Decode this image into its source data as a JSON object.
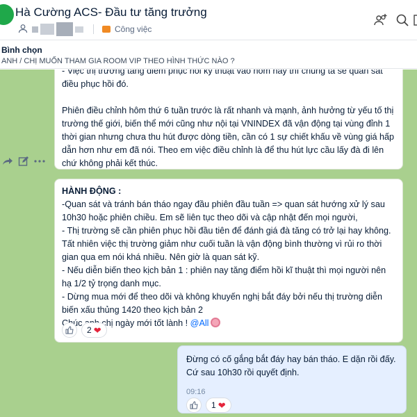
{
  "header": {
    "title": "Hà Cường ACS- Đầu tư tăng trưởng",
    "category": "Công việc",
    "icons": [
      "person-icon",
      "tag-icon",
      "add-member-icon",
      "search-icon",
      "sidebar-icon"
    ]
  },
  "poll": {
    "label": "Bình chọn",
    "question": "ANH / CHỊ MUỐN THAM GIA ROOM VIP THEO HÌNH THỨC NÀO ?"
  },
  "messages": {
    "first": {
      "lines": [
        "- Việc thị trường tăng điểm phục hồi kỹ thuật vào hôm nay thì chúng ta sẽ quan sát",
        "điều phục hồi đó.",
        "",
        "Phiên điều chỉnh hôm thứ 6 tuần trước là rất nhanh và mạnh, ảnh hưởng từ yếu tố thị",
        "trường thế giới, biến thể mới cũng như nội tại VNINDEX đã vận động tại vùng đỉnh 1",
        "thời gian nhưng chưa thu hút được dòng tiền, cần có 1 sự chiết khấu về vùng giá hấp",
        "dẫn hơn như em đã nói. Theo em việc điều chỉnh là để thu hút lực cầu lấy đà đi lên",
        "chứ không phải kết thúc."
      ]
    },
    "second": {
      "heading": "HÀNH ĐỘNG :",
      "lines": [
        "-Quan sát và tránh bán tháo ngay đầu phiên đầu tuần => quan sát hướng xử lý sau",
        "10h30 hoặc phiên chiều. Em sẽ liên tục theo dõi và cập nhật đến mọi người,",
        "- Thị trường sẽ cần phiên phục hồi đầu tiên để đánh giá đà tăng có trở lại hay không.",
        "Tất nhiên việc thị trường giảm như cuối tuần là vận động bình thường vì rủi ro thời",
        "gian qua em nói khá nhiều. Nên giờ là quan sát kỹ.",
        "- Nếu diễn biến theo kịch bản 1 : phiên nay tăng điểm hồi kĩ thuật thì mọi người nên",
        "hạ 1/2 tỷ trọng danh mục.",
        "- Dừng mua mới để theo dõi và không khuyến nghị bắt đáy bởi nếu thị trường diễn",
        "biến xấu thủng 1420 theo kịch bản 2"
      ],
      "closing": "Chúc anh chị ngày mới tốt lành ! ",
      "mention": "@All",
      "reaction_count": "2"
    },
    "third": {
      "lines": [
        "Đừng có cố gắng bắt đáy hay bán tháo. E dặn rồi đấy.",
        "Cứ sau 10h30 rồi quyết định."
      ],
      "time": "09:16",
      "reaction_count": "1"
    }
  },
  "colors": {
    "chat_background": "#a9d08e",
    "own_bubble": "#e5efff",
    "avatar": "#1fa84a",
    "mention": "#0068ff",
    "heart": "#e5243b"
  }
}
